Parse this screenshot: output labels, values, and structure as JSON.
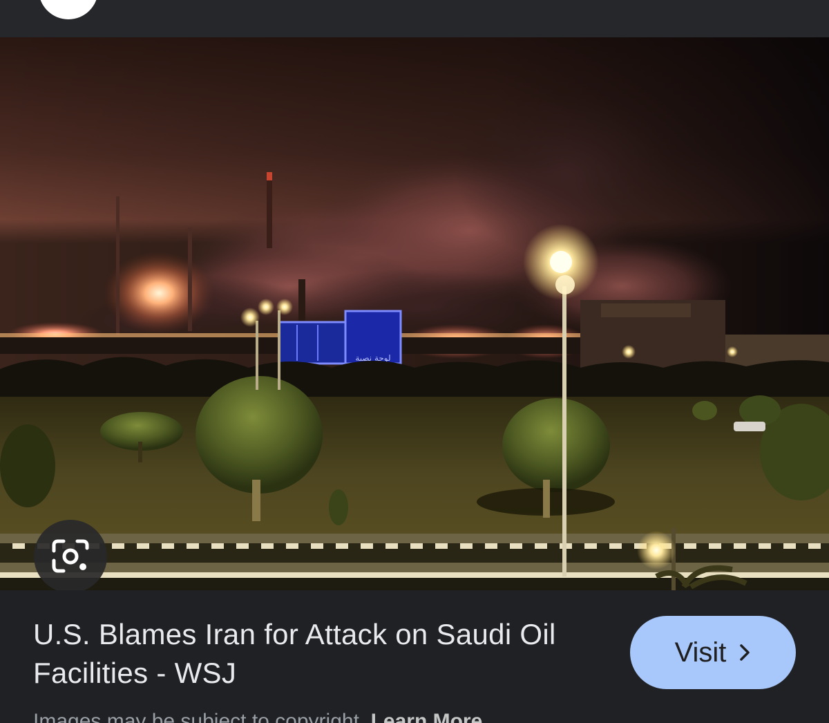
{
  "header": {
    "source_icon": "site-favicon"
  },
  "image": {
    "description_icon": "photo",
    "lens_icon": "lens-icon",
    "sign_text": "لوحة نصية"
  },
  "result": {
    "title": "U.S. Blames Iran for Attack on Saudi Oil Facilities - WSJ",
    "visit_label": "Visit",
    "visit_icon": "chevron-right-icon",
    "accent_color": "#a8c7fa"
  },
  "footer": {
    "copyright_text": "Images may be subject to copyright.",
    "learn_more_label": "Learn More"
  }
}
